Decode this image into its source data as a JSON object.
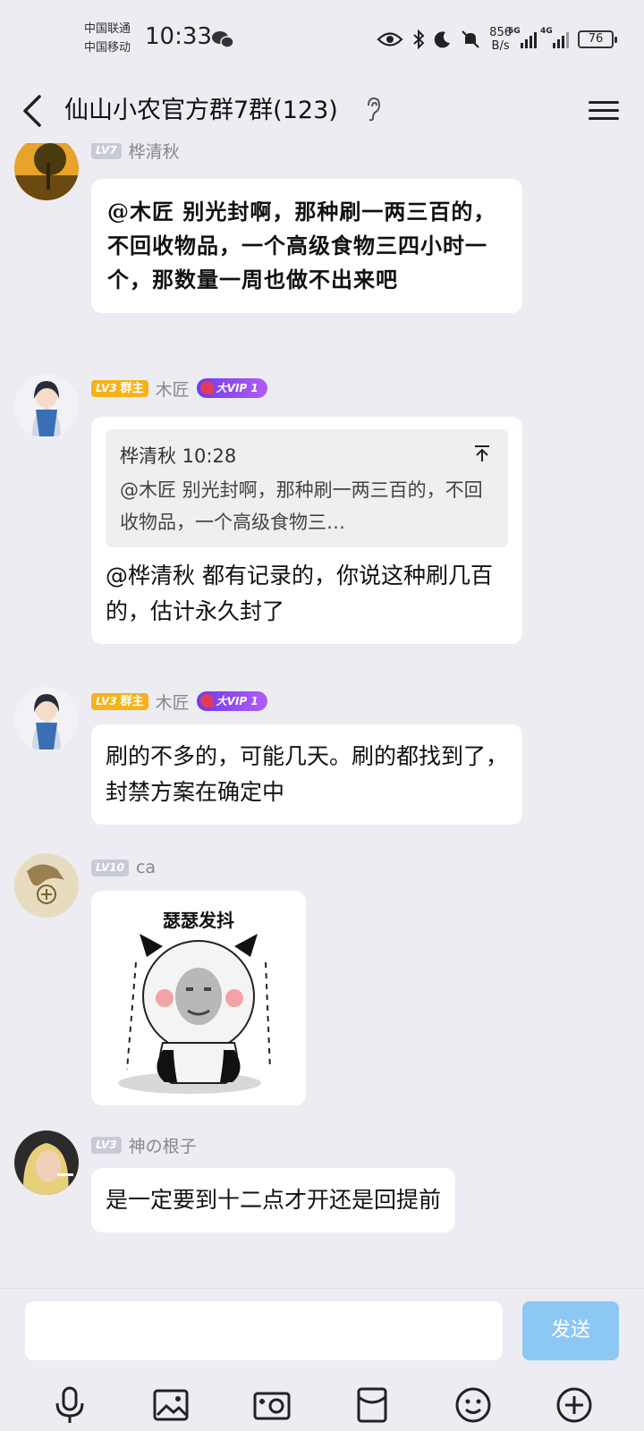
{
  "status_bar": {
    "carrier1": "中国联通",
    "carrier2": "中国移动",
    "time": "10:33",
    "net_speed_value": "856",
    "net_speed_unit": "B/s",
    "sig1_tag": "5G",
    "sig2_tag": "4G",
    "battery": "76"
  },
  "header": {
    "title": "仙山小农官方群7群(123)"
  },
  "messages": [
    {
      "level": "LV7",
      "nickname": "桦清秋",
      "text": "@木匠 别光封啊，那种刷一两三百的，不回收物品，一个高级食物三四小时一个，那数量一周也做不出来吧"
    },
    {
      "level": "LV3",
      "role": "群主",
      "nickname": "木匠",
      "vip": "大VIP 1",
      "quote_author_time": "桦清秋 10:28",
      "quote_text": "@木匠 别光封啊，那种刷一两三百的，不回收物品，一个高级食物三…",
      "text": "@桦清秋 都有记录的，你说这种刷几百的，估计永久封了"
    },
    {
      "level": "LV3",
      "role": "群主",
      "nickname": "木匠",
      "vip": "大VIP 1",
      "text": "刷的不多的，可能几天。刷的都找到了，封禁方案在确定中"
    },
    {
      "level": "LV10",
      "nickname": "ca",
      "sticker_caption": "瑟瑟发抖"
    },
    {
      "level": "LV3",
      "nickname": "神の根子",
      "text": "是一定要到十二点才开还是回提前"
    }
  ],
  "input_bar": {
    "placeholder": "",
    "send_label": "发送"
  },
  "colors": {
    "background": "#ececf2",
    "bubble": "#ffffff",
    "send_button": "#8dc8f4",
    "owner_badge": "#f5b21a"
  }
}
